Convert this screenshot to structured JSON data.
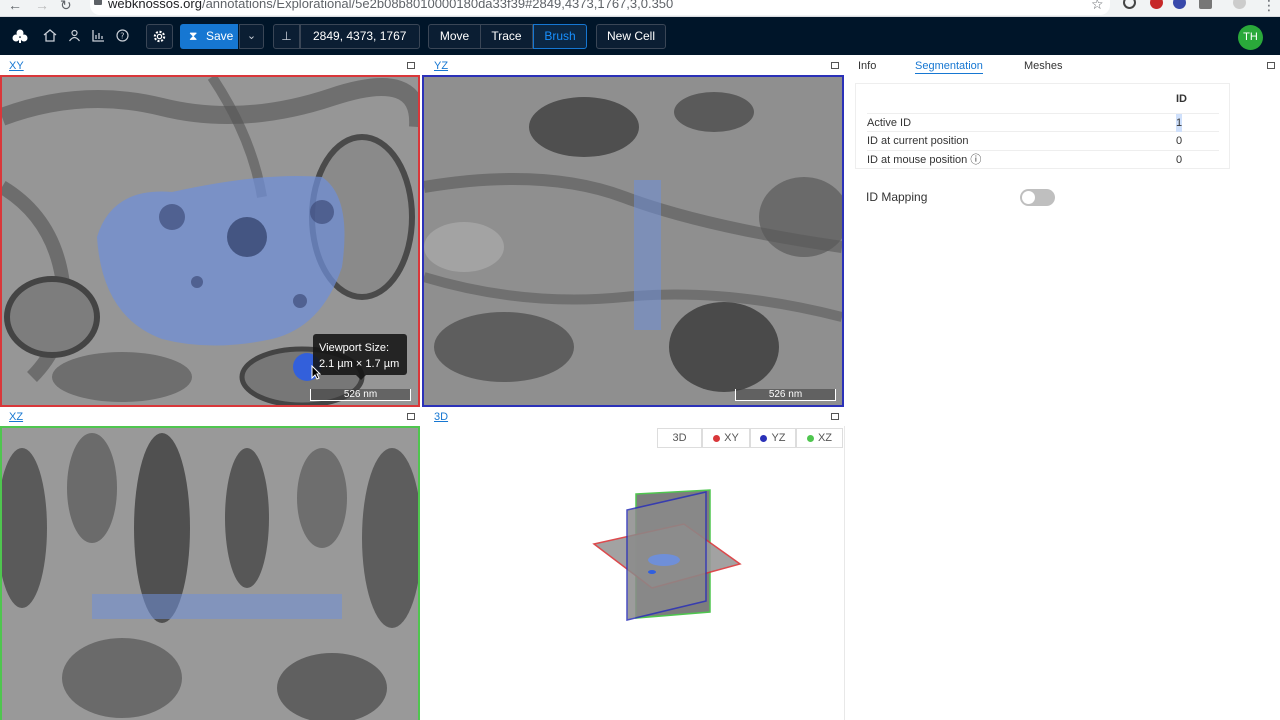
{
  "browser": {
    "url_domain": "webknossos.org",
    "url_path": "/annotations/Explorational/5e2b08b8010000180da33f39#2849,4373,1767,3,0.350"
  },
  "toolbar": {
    "save_label": "Save",
    "position": "2849, 4373, 1767",
    "tools": [
      {
        "label": "Move",
        "active": false
      },
      {
        "label": "Trace",
        "active": false
      },
      {
        "label": "Brush",
        "active": true
      }
    ],
    "new_cell_label": "New Cell",
    "avatar_initials": "TH"
  },
  "viewports": {
    "xy": {
      "label": "XY",
      "scale": "526 nm",
      "border_color": "#d9373a"
    },
    "yz": {
      "label": "YZ",
      "scale": "526 nm",
      "border_color": "#2b31b8"
    },
    "xz": {
      "label": "XZ",
      "border_color": "#4fc64f"
    },
    "td": {
      "label": "3D"
    }
  },
  "tooltip": {
    "line1": "Viewport Size:",
    "line2": "2.1 µm × 1.7 µm"
  },
  "legend3d": [
    {
      "label": "3D",
      "color": ""
    },
    {
      "label": "XY",
      "color": "#d9373a"
    },
    {
      "label": "YZ",
      "color": "#2b31b8"
    },
    {
      "label": "XZ",
      "color": "#4fc64f"
    }
  ],
  "panel": {
    "tabs": [
      "Info",
      "Segmentation",
      "Meshes"
    ],
    "active_tab": "Segmentation",
    "table_header": "ID",
    "rows": [
      {
        "label": "Active ID",
        "value": "1"
      },
      {
        "label": "ID at current position",
        "value": "0"
      },
      {
        "label": "ID at mouse position ⓘ",
        "value": "0"
      }
    ],
    "mapping_label": "ID Mapping",
    "mapping_enabled": false
  },
  "colors": {
    "accent": "#1677d2",
    "toolbar_bg": "#001529",
    "segment": "#6f8fd8"
  }
}
